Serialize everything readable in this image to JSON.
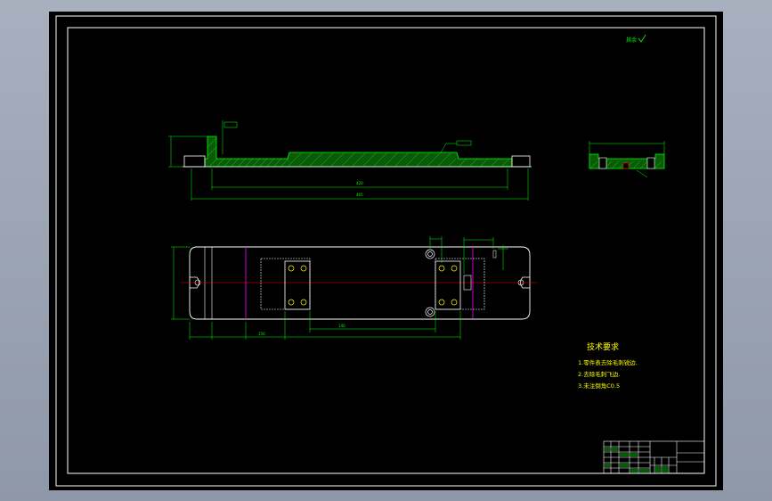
{
  "roughness_mark": "其余",
  "tech_requirements": {
    "title": "技术要求",
    "items": [
      "1.零件表去除毛刺锐边.",
      "2.去除毛刺飞边.",
      "3.未注倒角C0.5"
    ]
  },
  "colors": {
    "border": "#ffffff",
    "outline": "#ffffff",
    "dimension": "#00ff00",
    "centerline": "#ff0000",
    "hidden": "#ff00ff",
    "hatch": "#00ff00",
    "hole": "#ffff00",
    "title_block": "#ffffff",
    "tech_text": "#ffff00"
  }
}
